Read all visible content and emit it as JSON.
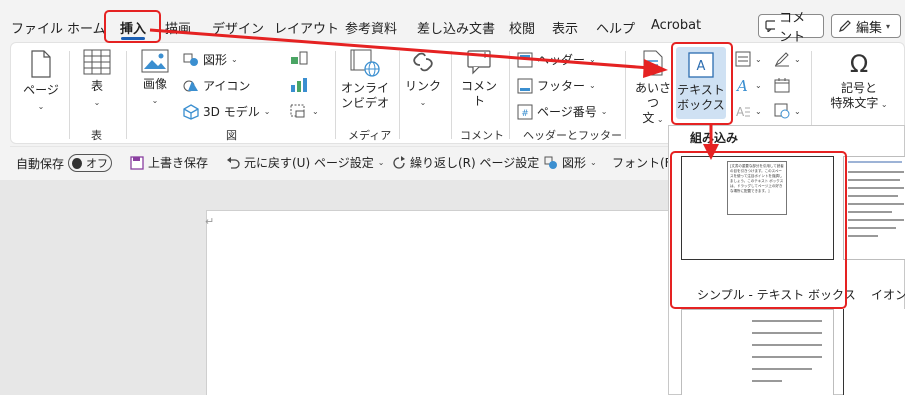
{
  "tabs": [
    "ファイル",
    "ホーム",
    "挿入",
    "描画",
    "デザイン",
    "レイアウト",
    "参考資料",
    "差し込み文書",
    "校閲",
    "表示",
    "ヘルプ",
    "Acrobat"
  ],
  "active_tab": "挿入",
  "top_buttons": {
    "comment": "コメント",
    "edit": "編集"
  },
  "ribbon": {
    "page": "ページ",
    "table": "表",
    "table_group": "表",
    "image": "画像",
    "shapes": "図形",
    "icons": "アイコン",
    "model3d": "3D モデル",
    "figures_group": "図",
    "online_video_1": "オンライ",
    "online_video_2": "ンビデオ",
    "media_group": "メディア",
    "link": "リンク",
    "comment": "コメント",
    "comment_group": "コメント",
    "header": "ヘッダー",
    "footer": "フッター",
    "page_number": "ページ番号",
    "hf_group": "ヘッダーとフッター",
    "greeting_1": "あいさつ",
    "greeting_2": "文",
    "textbox_1": "テキスト",
    "textbox_2": "ボックス",
    "symbol_1": "記号と",
    "symbol_2": "特殊文字"
  },
  "qat": {
    "autosave": "自動保存",
    "toggle": "オフ",
    "save": "上書き保存",
    "undo": "元に戻す(U) ページ設定",
    "redo": "繰り返し(R) ページ設定",
    "shapes": "図形",
    "font": "フォント(F):"
  },
  "doc": {
    "para_mark": "↵"
  },
  "gallery": {
    "section": "組み込み",
    "item1_caption": "シンプル - テキスト ボックス",
    "item2_caption": "イオン -",
    "item1_text": "[文書の重要な部分を引用して読者の目を引きつけます。このスペースを使って注目ポイントを強調しましょう。このテキスト ボックスは、ドラッグしてページ上の好きな場所に配置できます。]"
  },
  "colors": {
    "annotation": "#e52222",
    "accent": "#1a5fb4"
  }
}
